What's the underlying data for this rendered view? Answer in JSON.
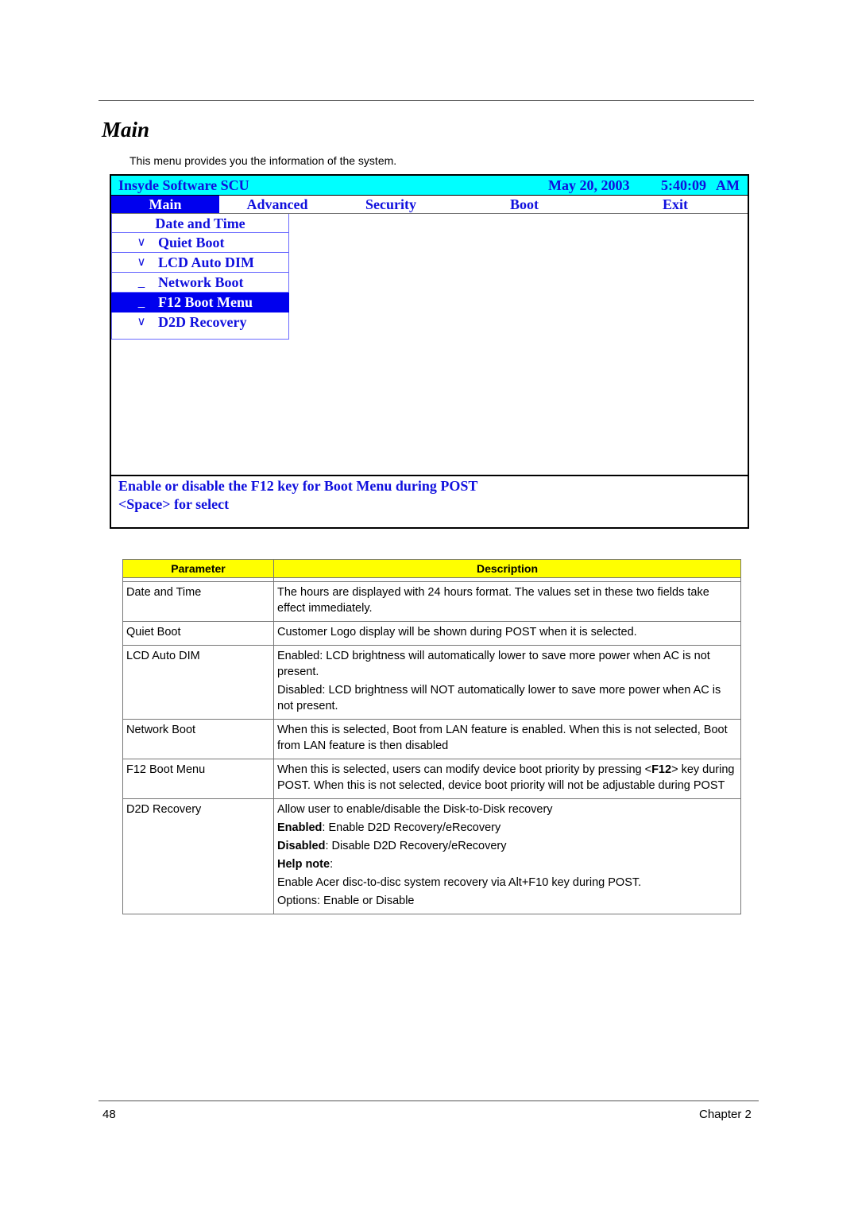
{
  "page": {
    "title": "Main",
    "intro": "This menu provides you the information of the system.",
    "page_number": "48",
    "chapter": "Chapter 2"
  },
  "bios": {
    "app_title": "Insyde Software SCU",
    "date": "May 20, 2003",
    "time": "5:40:09",
    "ampm": "AM",
    "colors": {
      "header_bg": "#00ffff",
      "text": "#1010dd",
      "selected_bg": "#0000ee"
    },
    "tabs": [
      {
        "label": "Main",
        "active": true
      },
      {
        "label": "Advanced",
        "active": false
      },
      {
        "label": "Security",
        "active": false
      },
      {
        "label": "Boot",
        "active": false
      },
      {
        "label": "Exit",
        "active": false
      }
    ],
    "menu_items": [
      {
        "mark": "",
        "label": "Date and Time",
        "selected": false
      },
      {
        "mark": "∨",
        "label": "Quiet Boot",
        "selected": false
      },
      {
        "mark": "∨",
        "label": "LCD Auto DIM",
        "selected": false
      },
      {
        "mark": "_",
        "label": "Network Boot",
        "selected": false
      },
      {
        "mark": "_",
        "label": "F12 Boot Menu",
        "selected": true
      },
      {
        "mark": "∨",
        "label": "D2D Recovery",
        "selected": false
      }
    ],
    "help_lines": [
      "Enable or disable the F12 key for Boot Menu during POST",
      "<Space> for select"
    ]
  },
  "table": {
    "headers": [
      "Parameter",
      "Description"
    ],
    "rows": [
      {
        "param": "Date and Time",
        "desc": [
          [
            {
              "t": "The hours are displayed with 24 hours format. The values set in these two fields take effect immediately."
            }
          ]
        ]
      },
      {
        "param": "Quiet Boot",
        "desc": [
          [
            {
              "t": "Customer Logo display will be shown during POST when it is selected."
            }
          ]
        ]
      },
      {
        "param": "LCD Auto DIM",
        "desc": [
          [
            {
              "t": "Enabled: LCD brightness will automatically lower to save more power when AC is not present."
            }
          ],
          [
            {
              "t": "Disabled: LCD brightness will NOT automatically lower to save more power when AC is not present."
            }
          ]
        ]
      },
      {
        "param": "Network Boot",
        "desc": [
          [
            {
              "t": "When this is selected, Boot from LAN feature is enabled. When this is not selected, Boot from LAN feature is then disabled"
            }
          ]
        ]
      },
      {
        "param": "F12 Boot Menu",
        "desc": [
          [
            {
              "t": "When this is selected, users can modify device boot priority by pressing <"
            },
            {
              "t": "F12",
              "b": true
            },
            {
              "t": "> key during POST. When this is not selected, device boot priority will not be adjustable during POST"
            }
          ]
        ]
      },
      {
        "param": "D2D Recovery",
        "desc": [
          [
            {
              "t": "Allow user to enable/disable the Disk-to-Disk recovery"
            }
          ],
          [
            {
              "t": "Enabled",
              "b": true
            },
            {
              "t": ": Enable D2D Recovery/eRecovery"
            }
          ],
          [
            {
              "t": "Disabled",
              "b": true
            },
            {
              "t": ": Disable D2D Recovery/eRecovery"
            }
          ],
          [
            {
              "t": "Help note",
              "b": true
            },
            {
              "t": ":"
            }
          ],
          [
            {
              "t": "Enable Acer disc-to-disc system recovery via Alt+F10 key during POST."
            }
          ],
          [
            {
              "t": "Options: Enable or Disable"
            }
          ]
        ]
      }
    ]
  }
}
